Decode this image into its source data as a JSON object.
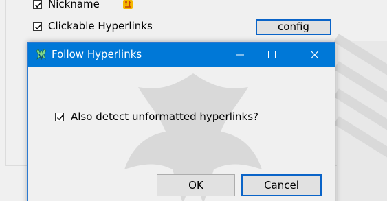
{
  "background": {
    "nickname_label": "Nickname",
    "nickname_checked": true,
    "hyperlinks_label": "Clickable Hyperlinks",
    "hyperlinks_checked": true,
    "config_button": "config"
  },
  "dialog": {
    "title": "Follow Hyperlinks",
    "checkbox_label": "Also detect unformatted hyperlinks?",
    "checkbox_checked": true,
    "ok_label": "OK",
    "cancel_label": "Cancel"
  },
  "colors": {
    "titlebar": "#0078d7",
    "accent_border": "#0a64c8",
    "window_bg": "#f0f0f0"
  }
}
